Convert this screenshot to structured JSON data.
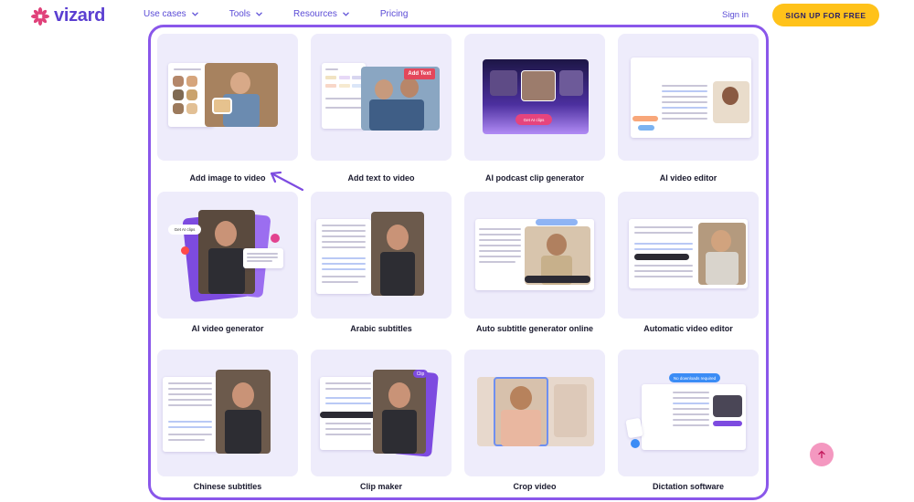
{
  "brand": {
    "name": "vizard",
    "logo_color": "#e0417a",
    "accent": "#5b3fd1"
  },
  "nav": {
    "items": [
      {
        "label": "Use cases",
        "dropdown": true
      },
      {
        "label": "Tools",
        "dropdown": true
      },
      {
        "label": "Resources",
        "dropdown": true
      },
      {
        "label": "Pricing",
        "dropdown": false
      }
    ],
    "signin": "Sign in",
    "signup": "SIGN UP FOR FREE"
  },
  "thumb_text": {
    "add_text": "Add Text",
    "get_ai_clips": "Get AI clips",
    "get_ai_clips_2": "Get AI clips",
    "clip": "Clip",
    "no_downloads": "No downloads required"
  },
  "cards": [
    {
      "label": "Add image to video"
    },
    {
      "label": "Add text to video"
    },
    {
      "label": "AI podcast clip generator"
    },
    {
      "label": "AI video editor"
    },
    {
      "label": "AI video generator"
    },
    {
      "label": "Arabic subtitles"
    },
    {
      "label": "Auto subtitle generator online"
    },
    {
      "label": "Automatic video editor"
    },
    {
      "label": "Chinese subtitles"
    },
    {
      "label": "Clip maker"
    },
    {
      "label": "Crop video"
    },
    {
      "label": "Dictation software"
    }
  ],
  "icons": {
    "logo": "vizard-flower-icon",
    "chevron": "chevron-down-icon",
    "arrow": "pointer-arrow-icon",
    "scroll_top": "arrow-up-icon"
  },
  "colors": {
    "frame": "#8a57ea",
    "card_bg": "#eeecfb",
    "signup_bg": "#ffc21a",
    "scroll_top_bg": "#f498c0"
  }
}
